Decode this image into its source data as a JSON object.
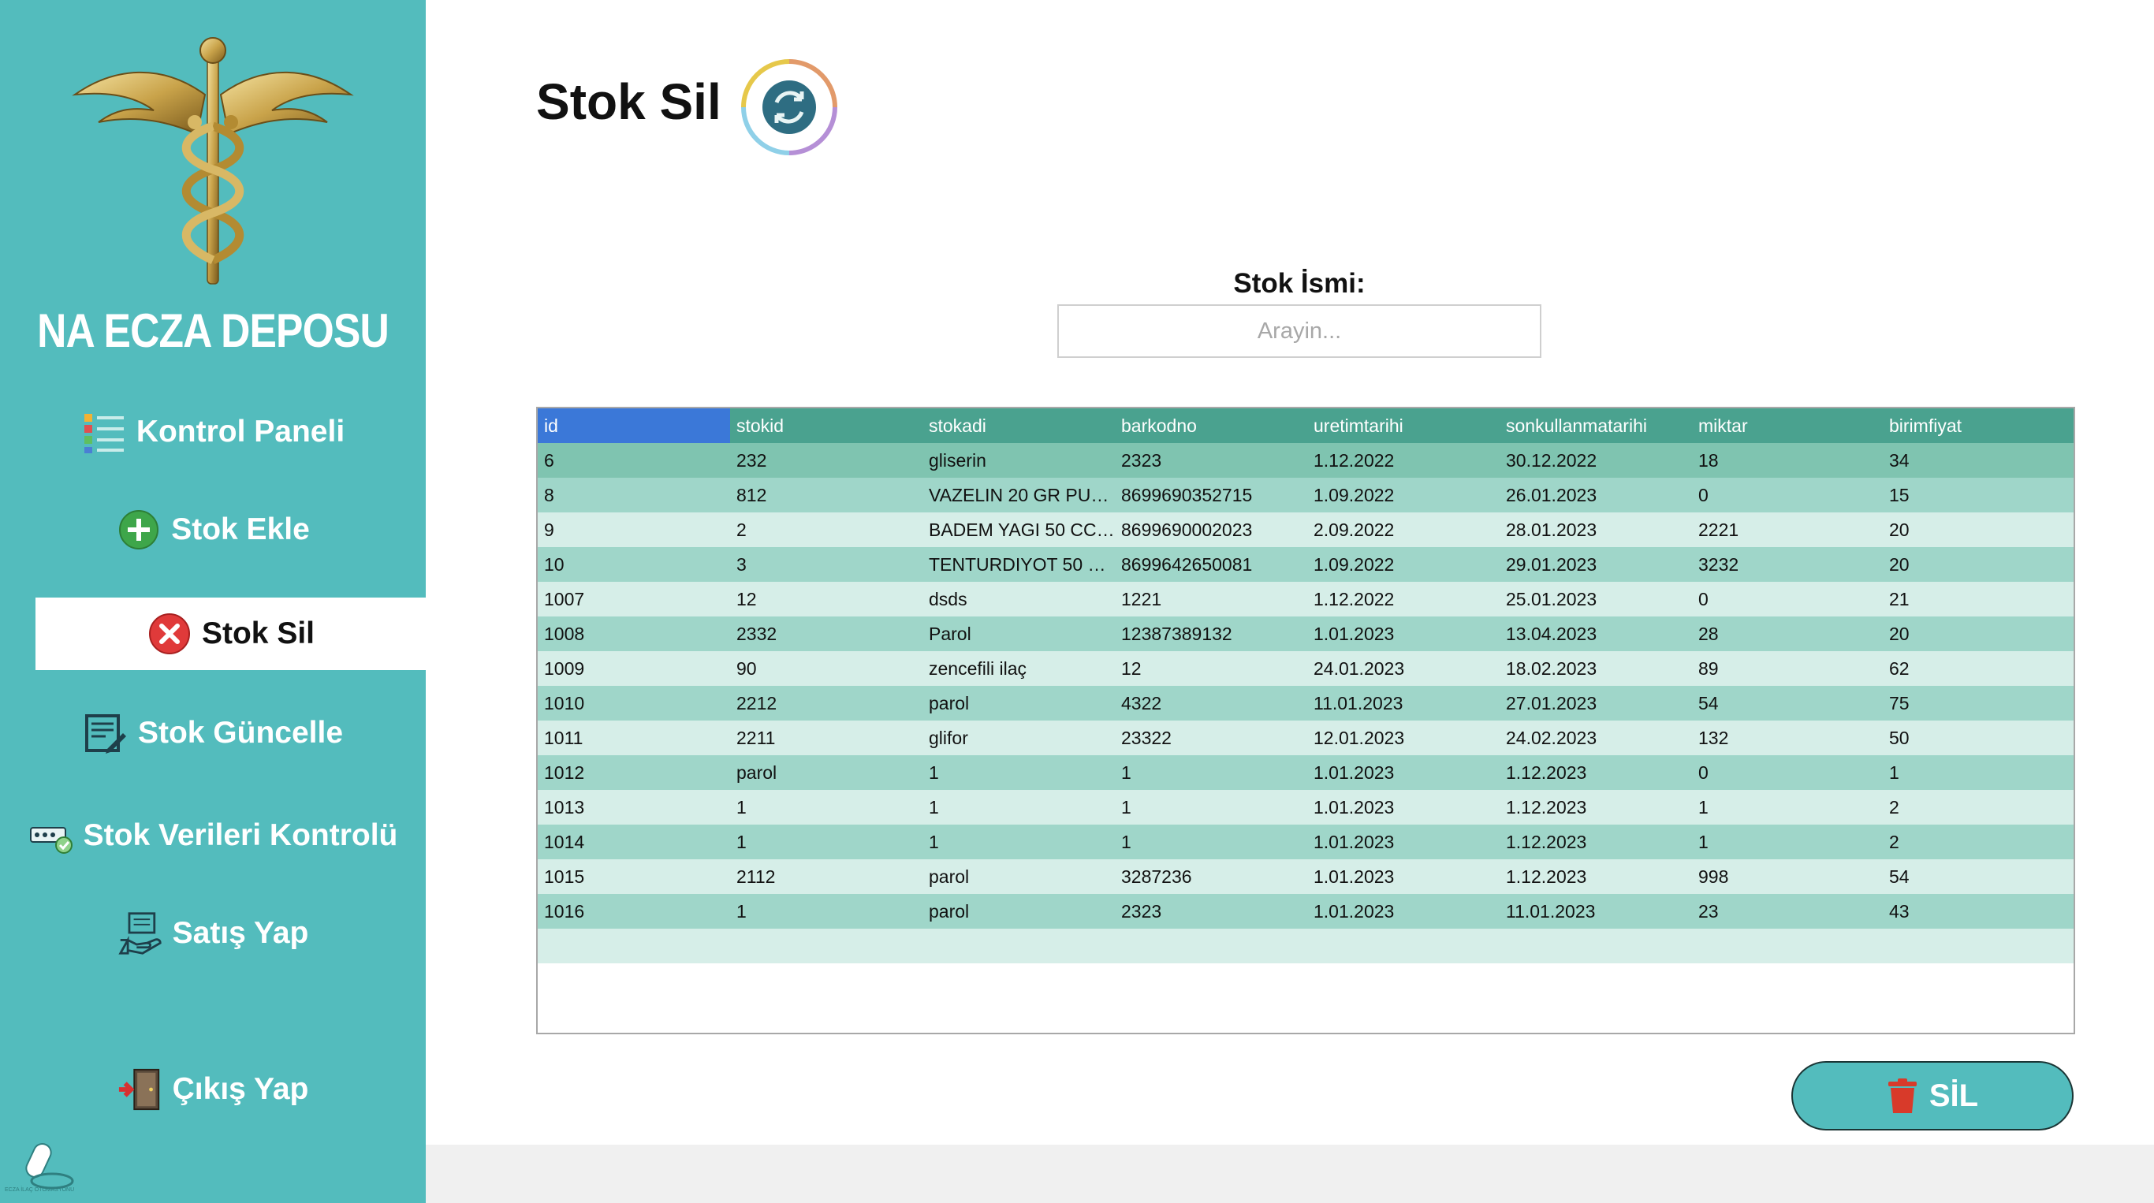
{
  "app": {
    "brand": "NA ECZA DEPOSU",
    "logo_caption": "ECZA İLAÇ OTOMASYONU"
  },
  "sidebar": {
    "items": [
      {
        "label": "Kontrol Paneli",
        "icon": "dashboard-icon"
      },
      {
        "label": "Stok Ekle",
        "icon": "add-icon"
      },
      {
        "label": "Stok Sil",
        "icon": "delete-icon",
        "active": true
      },
      {
        "label": "Stok Güncelle",
        "icon": "edit-icon"
      },
      {
        "label": "Stok Verileri Kontrolü",
        "icon": "check-data-icon"
      },
      {
        "label": "Satış Yap",
        "icon": "sale-icon"
      },
      {
        "label": "Çıkış Yap",
        "icon": "exit-icon"
      }
    ]
  },
  "main": {
    "title": "Stok Sil",
    "search": {
      "label": "Stok İsmi:",
      "placeholder": "Arayin...",
      "value": ""
    },
    "delete_button": "SİL"
  },
  "table": {
    "columns": [
      "id",
      "stokid",
      "stokadi",
      "barkodno",
      "uretimtarihi",
      "sonkullanmatarihi",
      "miktar",
      "birimfiyat"
    ],
    "rows": [
      [
        "6",
        "232",
        "gliserin",
        "2323",
        "1.12.2022",
        "30.12.2022",
        "18",
        "34"
      ],
      [
        "8",
        "812",
        "VAZELIN 20 GR PUR...",
        "8699690352715",
        "1.09.2022",
        "26.01.2023",
        "0",
        "15"
      ],
      [
        "9",
        "2",
        "BADEM YAGI 50 CC(...",
        "8699690002023",
        "2.09.2022",
        "28.01.2023",
        "2221",
        "20"
      ],
      [
        "10",
        "3",
        "TENTURDIYOT 50 M...",
        "8699642650081",
        "1.09.2022",
        "29.01.2023",
        "3232",
        "20"
      ],
      [
        "1007",
        "12",
        "dsds",
        "1221",
        "1.12.2022",
        "25.01.2023",
        "0",
        "21"
      ],
      [
        "1008",
        "2332",
        "Parol",
        "12387389132",
        "1.01.2023",
        "13.04.2023",
        "28",
        "20"
      ],
      [
        "1009",
        "90",
        "zencefili ilaç",
        "12",
        "24.01.2023",
        "18.02.2023",
        "89",
        "62"
      ],
      [
        "1010",
        "2212",
        "parol",
        "4322",
        "11.01.2023",
        "27.01.2023",
        "54",
        "75"
      ],
      [
        "1011",
        "2211",
        "glifor",
        "23322",
        "12.01.2023",
        "24.02.2023",
        "132",
        "50"
      ],
      [
        "1012",
        "parol",
        "1",
        "1",
        "1.01.2023",
        "1.12.2023",
        "0",
        "1"
      ],
      [
        "1013",
        "1",
        "1",
        "1",
        "1.01.2023",
        "1.12.2023",
        "1",
        "2"
      ],
      [
        "1014",
        "1",
        "1",
        "1",
        "1.01.2023",
        "1.12.2023",
        "1",
        "2"
      ],
      [
        "1015",
        "2112",
        "parol",
        "3287236",
        "1.01.2023",
        "1.12.2023",
        "998",
        "54"
      ],
      [
        "1016",
        "1",
        "parol",
        "2323",
        "1.01.2023",
        "11.01.2023",
        "23",
        "43"
      ]
    ]
  },
  "colors": {
    "sidebar": "#53bcbd",
    "header": "#4aa28f",
    "header_selected": "#3b78d8",
    "row_odd": "#9fd6c9",
    "row_even": "#d6eee8"
  }
}
